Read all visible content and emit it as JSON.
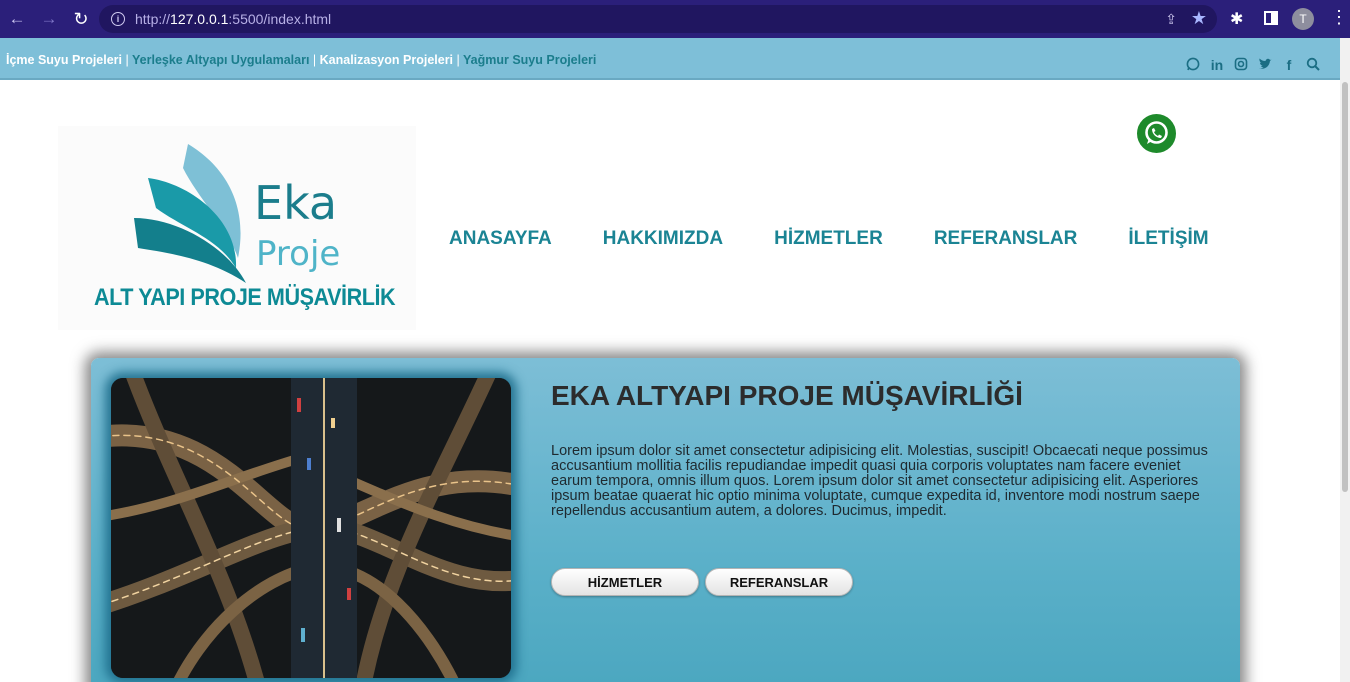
{
  "browser": {
    "url_prefix": "http://",
    "url_host": "127.0.0.1",
    "url_rest": ":5500/index.html",
    "avatar_letter": "T"
  },
  "topbar": {
    "links": [
      "İçme Suyu Projeleri",
      "Yerleşke Altyapı Uygulamaları",
      "Kanalizasyon Projeleri",
      "Yağmur Suyu Projeleri"
    ],
    "separator": "|",
    "social_icons": [
      "whatsapp-icon",
      "linkedin-icon",
      "instagram-icon",
      "twitter-icon",
      "facebook-icon",
      "search-icon"
    ]
  },
  "logo": {
    "word1": "Eka",
    "word2": "Proje",
    "tagline": "ALT YAPI PROJE MÜŞAVİRLİK"
  },
  "nav": {
    "items": [
      "ANASAYFA",
      "HAKKIMIZDA",
      "HİZMETLER",
      "REFERANSLAR",
      "İLETİŞİM"
    ]
  },
  "hero": {
    "title": "EKA ALTYAPI PROJE MÜŞAVİRLİĞİ",
    "text": "Lorem ipsum dolor sit amet consectetur adipisicing elit. Molestias, suscipit! Obcaecati neque possimus accusantium mollitia facilis repudiandae impedit quasi quia corporis voluptates nam facere eveniet earum tempora, omnis illum quos. Lorem ipsum dolor sit amet consectetur adipisicing elit. Asperiores ipsum beatae quaerat hic optio minima voluptate, cumque expedita id, inventore modi nostrum saepe repellendus accusantium autem, a dolores. Ducimus, impedit.",
    "button1": "HİZMETLER",
    "button2": "REFERANSLAR"
  },
  "colors": {
    "chrome": "#2b1f7a",
    "topbar": "#7ebfd8",
    "brand_teal": "#1b8494",
    "whatsapp": "#1e8a2b"
  }
}
